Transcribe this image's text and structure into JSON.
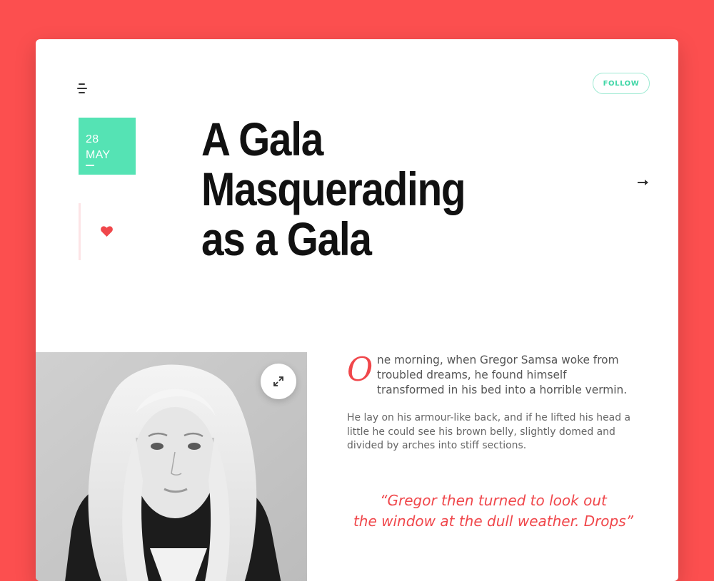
{
  "header": {
    "follow_label": "FOLLOW"
  },
  "post": {
    "date": {
      "day": "28",
      "month": "MAY"
    },
    "title_lines": [
      "A Gala",
      "Masquerading",
      "as a Gala"
    ],
    "lead_drop_cap": "O",
    "lead_text": "ne morning, when Gregor Samsa woke from  troubled dreams, he found himself transformed in his bed into a horrible vermin.",
    "paragraph": "He lay on his armour-like back, and if he lifted his head a little he could see his brown belly, slightly domed and divided by arches into stiff sections.",
    "quote_lines": [
      "“Gregor then turned to look out",
      "the window at the dull weather. Drops”"
    ]
  },
  "icons": {
    "menu": "menu-icon",
    "heart": "heart-icon",
    "next": "arrow-right-icon",
    "expand": "expand-icon"
  },
  "colors": {
    "background": "#fc4f4f",
    "accent_green": "#55e3b4",
    "accent_red": "#f0474b",
    "follow_text": "#3fd6a6"
  }
}
